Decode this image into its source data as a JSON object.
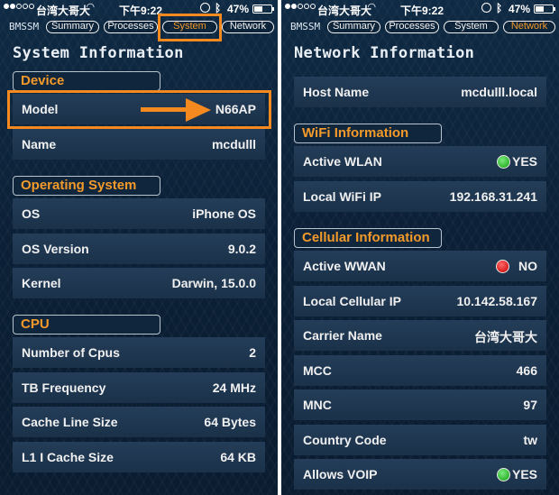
{
  "status_bar": {
    "carrier": "台湾大哥大",
    "time": "下午9:22",
    "battery": "47%"
  },
  "nav": {
    "brand": "BMSSM",
    "tabs": [
      "Summary",
      "Processes",
      "System",
      "Network"
    ]
  },
  "left": {
    "title": "System Information",
    "active_tab": "System",
    "sections": {
      "device": "Device",
      "os": "Operating System",
      "cpu": "CPU"
    },
    "rows": {
      "model": {
        "label": "Model",
        "value": "N66AP"
      },
      "name": {
        "label": "Name",
        "value": "mcdulll"
      },
      "os": {
        "label": "OS",
        "value": "iPhone OS"
      },
      "os_version": {
        "label": "OS Version",
        "value": "9.0.2"
      },
      "kernel": {
        "label": "Kernel",
        "value": "Darwin, 15.0.0"
      },
      "cpus": {
        "label": "Number of Cpus",
        "value": "2"
      },
      "tb_freq": {
        "label": "TB Frequency",
        "value": "24 MHz"
      },
      "cache_line": {
        "label": "Cache Line Size",
        "value": "64 Bytes"
      },
      "l1i_cache": {
        "label": "L1 I Cache Size",
        "value": "64 KB"
      }
    }
  },
  "right": {
    "title": "Network Information",
    "active_tab": "Network",
    "sections": {
      "wifi": "WiFi Information",
      "cellular": "Cellular Information"
    },
    "rows": {
      "host_name": {
        "label": "Host Name",
        "value": "mcdulll.local"
      },
      "active_wlan": {
        "label": "Active WLAN",
        "value": "YES",
        "indicator": "green"
      },
      "wifi_ip": {
        "label": "Local WiFi IP",
        "value": "192.168.31.241"
      },
      "active_wwan": {
        "label": "Active WWAN",
        "value": "NO",
        "indicator": "red"
      },
      "cell_ip": {
        "label": "Local Cellular IP",
        "value": "10.142.58.167"
      },
      "carrier_name": {
        "label": "Carrier Name",
        "value": "台湾大哥大"
      },
      "mcc": {
        "label": "MCC",
        "value": "466"
      },
      "mnc": {
        "label": "MNC",
        "value": "97"
      },
      "country_code": {
        "label": "Country Code",
        "value": "tw"
      },
      "voip": {
        "label": "Allows VOIP",
        "value": "YES",
        "indicator": "green"
      }
    }
  },
  "colors": {
    "accent_orange": "#f4891f",
    "section_text": "#f39a2b",
    "background": "#0d243b",
    "row_bg": "#213a54"
  },
  "icons": [
    "wifi-icon",
    "lock-rotation-icon",
    "bluetooth-icon",
    "battery-icon",
    "arrow-right-icon"
  ]
}
